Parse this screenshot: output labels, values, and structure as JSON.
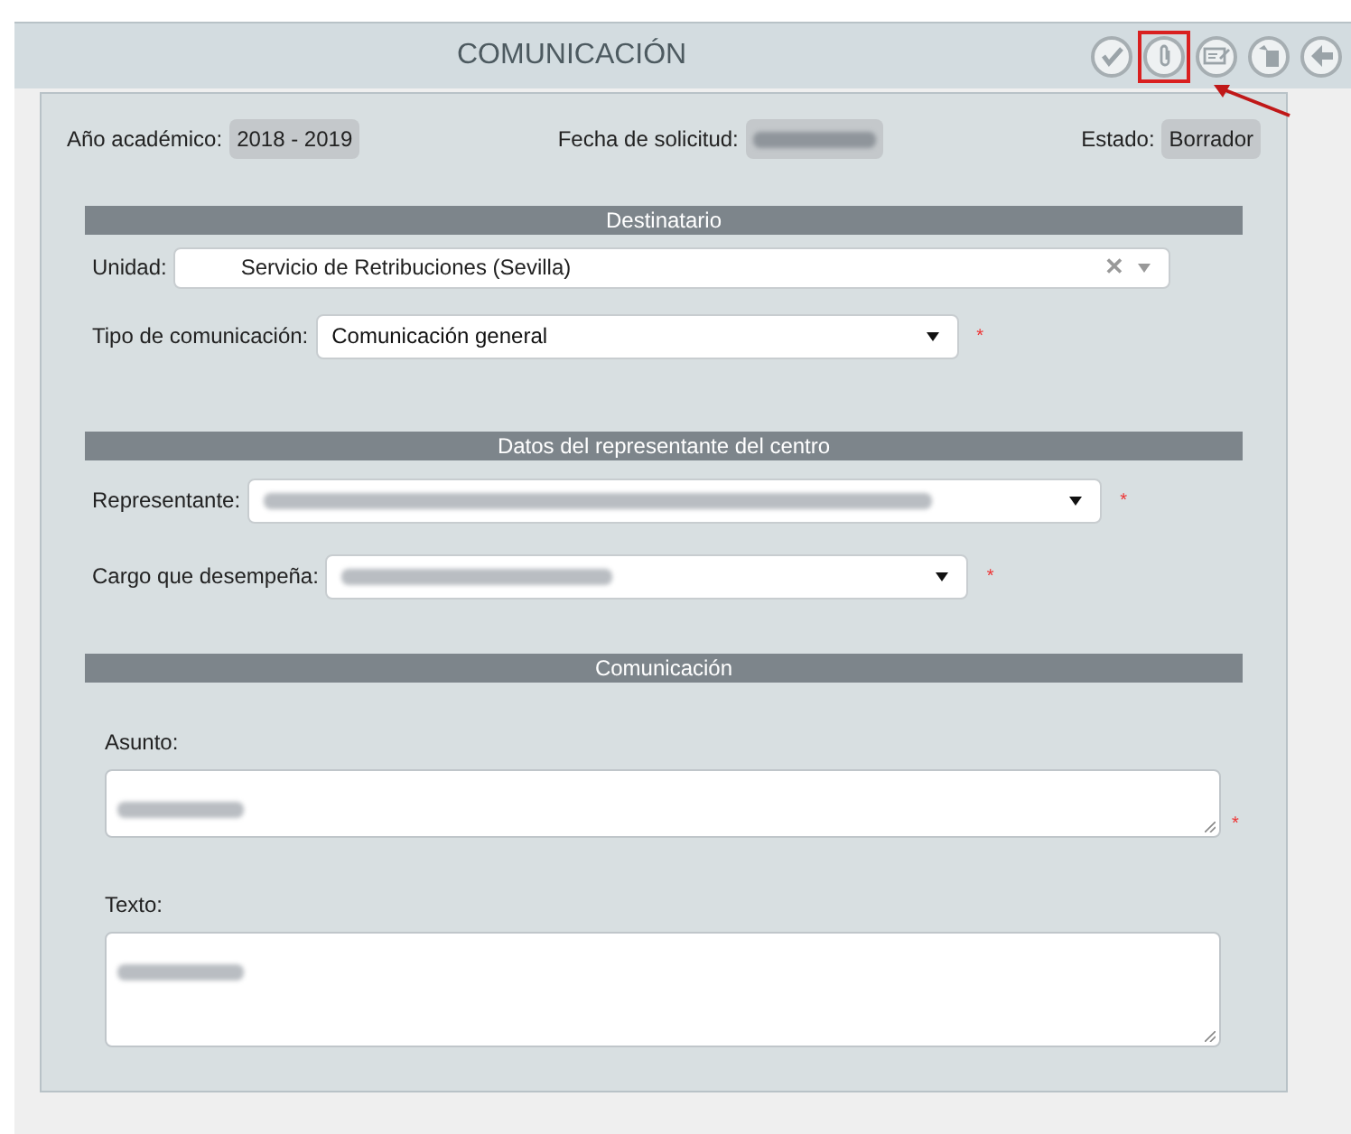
{
  "header": {
    "title": "COMUNICACIÓN",
    "tools": [
      {
        "kind": "check",
        "highlighted": false
      },
      {
        "kind": "attach",
        "highlighted": true
      },
      {
        "kind": "edit",
        "highlighted": false
      },
      {
        "kind": "copy",
        "highlighted": false
      },
      {
        "kind": "back",
        "highlighted": false
      }
    ]
  },
  "info": [
    {
      "label": "Año académico:",
      "value": "2018 - 2019"
    },
    {
      "label": "Fecha de solicitud:",
      "redacted": true
    },
    {
      "label": "Estado:",
      "value": "Borrador"
    }
  ],
  "sections": [
    {
      "title": "Destinatario",
      "fields": [
        {
          "label": "Unidad:",
          "kind": "combo",
          "value": "Servicio de Retribuciones (Sevilla)",
          "clear": "✕"
        },
        {
          "label": "Tipo de comunicación:",
          "kind": "select",
          "value": "Comunicación general",
          "required_mark": "*"
        }
      ]
    },
    {
      "title": "Datos del representante del centro",
      "fields": [
        {
          "label": "Representante:",
          "kind": "select",
          "redacted": true,
          "required_mark": "*"
        },
        {
          "label": "Cargo que desempeña:",
          "kind": "select",
          "redacted": true,
          "required_mark": "*"
        }
      ]
    },
    {
      "title": "Comunicación",
      "fields": [
        {
          "label": "Asunto:",
          "kind": "textarea",
          "redacted": true,
          "required_mark": "*"
        },
        {
          "label": "Texto:",
          "kind": "textarea",
          "redacted": true
        }
      ]
    }
  ]
}
